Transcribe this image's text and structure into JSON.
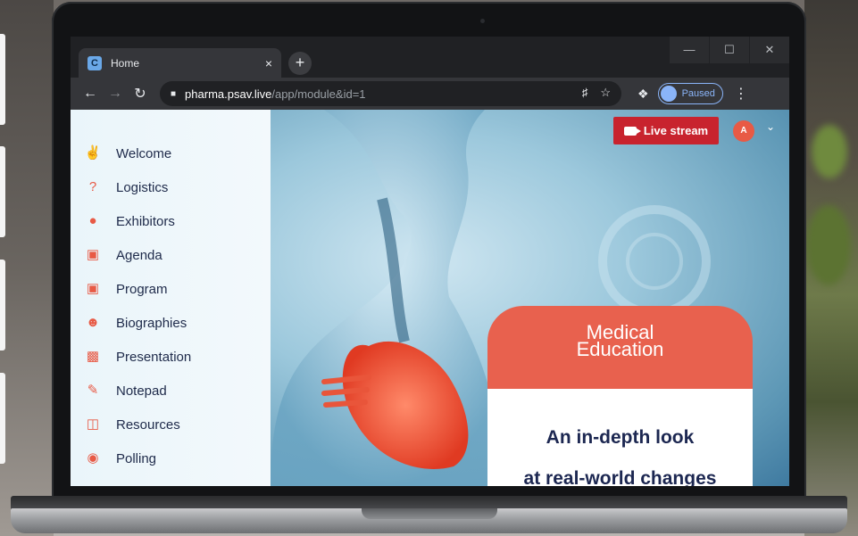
{
  "browser": {
    "tab_title": "Home",
    "tab_favicon_letter": "C",
    "tab_close": "×",
    "new_tab": "+",
    "url_host": "pharma.psav.live",
    "url_path": "/app/module&id=1",
    "profile_status": "Paused",
    "window_minimize": "—",
    "window_maximize": "☐",
    "window_close": "✕"
  },
  "sidebar": {
    "items": [
      {
        "label": "Welcome",
        "icon": "handshake-icon"
      },
      {
        "label": "Logistics",
        "icon": "question-bubble-icon"
      },
      {
        "label": "Exhibitors",
        "icon": "people-group-icon"
      },
      {
        "label": "Agenda",
        "icon": "calendar-icon"
      },
      {
        "label": "Program",
        "icon": "calendar-icon"
      },
      {
        "label": "Biographies",
        "icon": "users-icon"
      },
      {
        "label": "Presentation",
        "icon": "presentation-board-icon"
      },
      {
        "label": "Notepad",
        "icon": "notepad-icon"
      },
      {
        "label": "Resources",
        "icon": "pdf-file-icon"
      },
      {
        "label": "Polling",
        "icon": "poll-bubble-icon"
      }
    ]
  },
  "header": {
    "live_stream_label": "Live stream",
    "avatar_initial": "A"
  },
  "card": {
    "title_line1": "Medical",
    "title_line2": "Education",
    "body_line1": "An in-depth look",
    "body_line2": "at real-world changes"
  },
  "colors": {
    "accent": "#e8614e",
    "live_button": "#c8232e",
    "navy_text": "#1c2751"
  }
}
